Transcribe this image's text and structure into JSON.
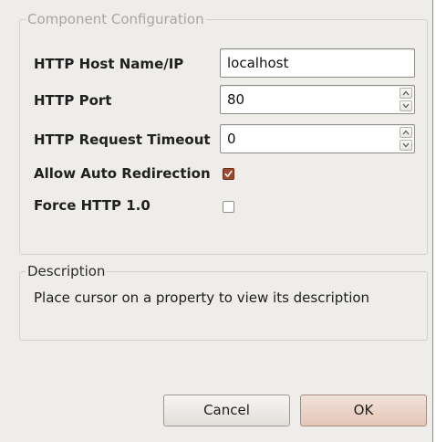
{
  "config_group": {
    "legend": "Component Configuration"
  },
  "fields": {
    "host": {
      "label": "HTTP Host Name/IP",
      "value": "localhost"
    },
    "port": {
      "label": "HTTP Port",
      "value": "80"
    },
    "timeout": {
      "label": "HTTP Request Timeout",
      "value": "0"
    },
    "auto_redirect": {
      "label": "Allow Auto Redirection",
      "checked": true
    },
    "force_http10": {
      "label": "Force HTTP 1.0",
      "checked": false
    }
  },
  "description": {
    "legend": "Description",
    "text": "Place cursor on a property to view its description"
  },
  "buttons": {
    "cancel_label": "Cancel",
    "ok_label": "OK"
  },
  "icons": {
    "spin_up": "chevron-up-icon",
    "spin_down": "chevron-down-icon",
    "check": "checkmark-icon"
  },
  "colors": {
    "background": "#efede9",
    "checkbox_checked": "#9a4a2e",
    "ok_button": "#e5c6b7"
  }
}
